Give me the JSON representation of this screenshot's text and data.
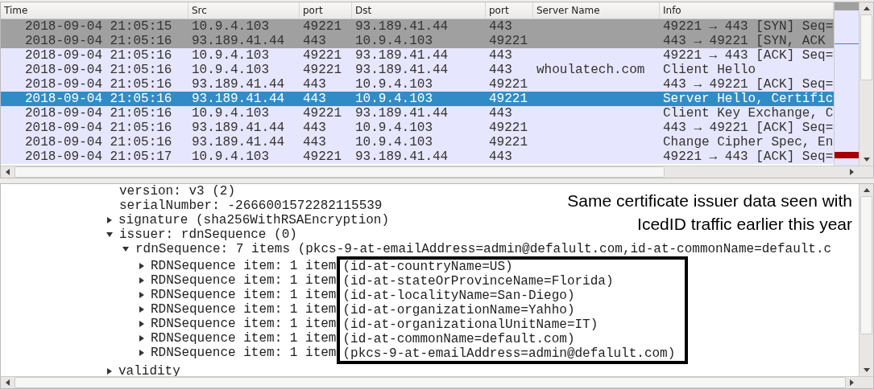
{
  "packet_list": {
    "columns": [
      "Time",
      "Src",
      "port",
      "Dst",
      "port",
      "Server Name",
      "Info"
    ],
    "rows": [
      {
        "cells": [
          "2018-09-04 21:05:15",
          "10.9.4.103",
          "49221",
          "93.189.41.44",
          "443",
          "",
          "49221 → 443 [SYN] Seq="
        ],
        "kind": "syn",
        "selected": false
      },
      {
        "cells": [
          "2018-09-04 21:05:16",
          "93.189.41.44",
          "443",
          "10.9.4.103",
          "49221",
          "",
          "443 → 49221 [SYN, ACK"
        ],
        "kind": "syn",
        "selected": false
      },
      {
        "cells": [
          "2018-09-04 21:05:16",
          "10.9.4.103",
          "49221",
          "93.189.41.44",
          "443",
          "",
          "49221 → 443 [ACK] Seq="
        ],
        "kind": "tcp",
        "selected": false
      },
      {
        "cells": [
          "2018-09-04 21:05:16",
          "10.9.4.103",
          "49221",
          "93.189.41.44",
          "443",
          "whoulatech.com",
          "Client Hello"
        ],
        "kind": "tcp",
        "selected": false
      },
      {
        "cells": [
          "2018-09-04 21:05:16",
          "93.189.41.44",
          "443",
          "10.9.4.103",
          "49221",
          "",
          "443 → 49221 [ACK] Seq="
        ],
        "kind": "tcp",
        "selected": false
      },
      {
        "cells": [
          "2018-09-04 21:05:16",
          "93.189.41.44",
          "443",
          "10.9.4.103",
          "49221",
          "",
          "Server Hello, Certific"
        ],
        "kind": "tcp",
        "selected": true
      },
      {
        "cells": [
          "2018-09-04 21:05:16",
          "10.9.4.103",
          "49221",
          "93.189.41.44",
          "443",
          "",
          "Client Key Exchange, C"
        ],
        "kind": "tcp",
        "selected": false
      },
      {
        "cells": [
          "2018-09-04 21:05:16",
          "93.189.41.44",
          "443",
          "10.9.4.103",
          "49221",
          "",
          "443 → 49221 [ACK] Seq="
        ],
        "kind": "tcp",
        "selected": false
      },
      {
        "cells": [
          "2018-09-04 21:05:16",
          "93.189.41.44",
          "443",
          "10.9.4.103",
          "49221",
          "",
          "Change Cipher Spec, En"
        ],
        "kind": "tcp",
        "selected": false
      },
      {
        "cells": [
          "2018-09-04 21:05:17",
          "10.9.4.103",
          "49221",
          "93.189.41.44",
          "443",
          "",
          "49221 → 443 [ACK] Seq="
        ],
        "kind": "tcp",
        "selected": false
      }
    ]
  },
  "detail_tree": [
    {
      "text": "version: v3 (2)"
    },
    {
      "text": "serialNumber: -2666001572282115539"
    },
    {
      "text": "signature (sha256WithRSAEncryption)",
      "expanded": false
    },
    {
      "text": "issuer: rdnSequence (0)",
      "expanded": true,
      "children": [
        {
          "text": "rdnSequence: 7 items (pkcs-9-at-emailAddress=admin@defalult.com,id-at-commonName=default.c",
          "expanded": true,
          "boxed_values": true,
          "children": [
            {
              "text": "RDNSequence item: 1 item",
              "value": "(id-at-countryName=US)",
              "expanded": false
            },
            {
              "text": "RDNSequence item: 1 item",
              "value": "(id-at-stateOrProvinceName=Florida)",
              "expanded": false
            },
            {
              "text": "RDNSequence item: 1 item",
              "value": "(id-at-localityName=San-Diego)",
              "expanded": false
            },
            {
              "text": "RDNSequence item: 1 item",
              "value": "(id-at-organizationName=Yahho)",
              "expanded": false
            },
            {
              "text": "RDNSequence item: 1 item",
              "value": "(id-at-organizationalUnitName=IT)",
              "expanded": false
            },
            {
              "text": "RDNSequence item: 1 item",
              "value": "(id-at-commonName=default.com)",
              "expanded": false
            },
            {
              "text": "RDNSequence item: 1 item",
              "value": "(pkcs-9-at-emailAddress=admin@defalult.com)",
              "expanded": false
            }
          ]
        }
      ]
    },
    {
      "text": "validity",
      "expanded": false
    }
  ],
  "annotation": "Same certificate issuer data seen with IcedID traffic earlier this year"
}
